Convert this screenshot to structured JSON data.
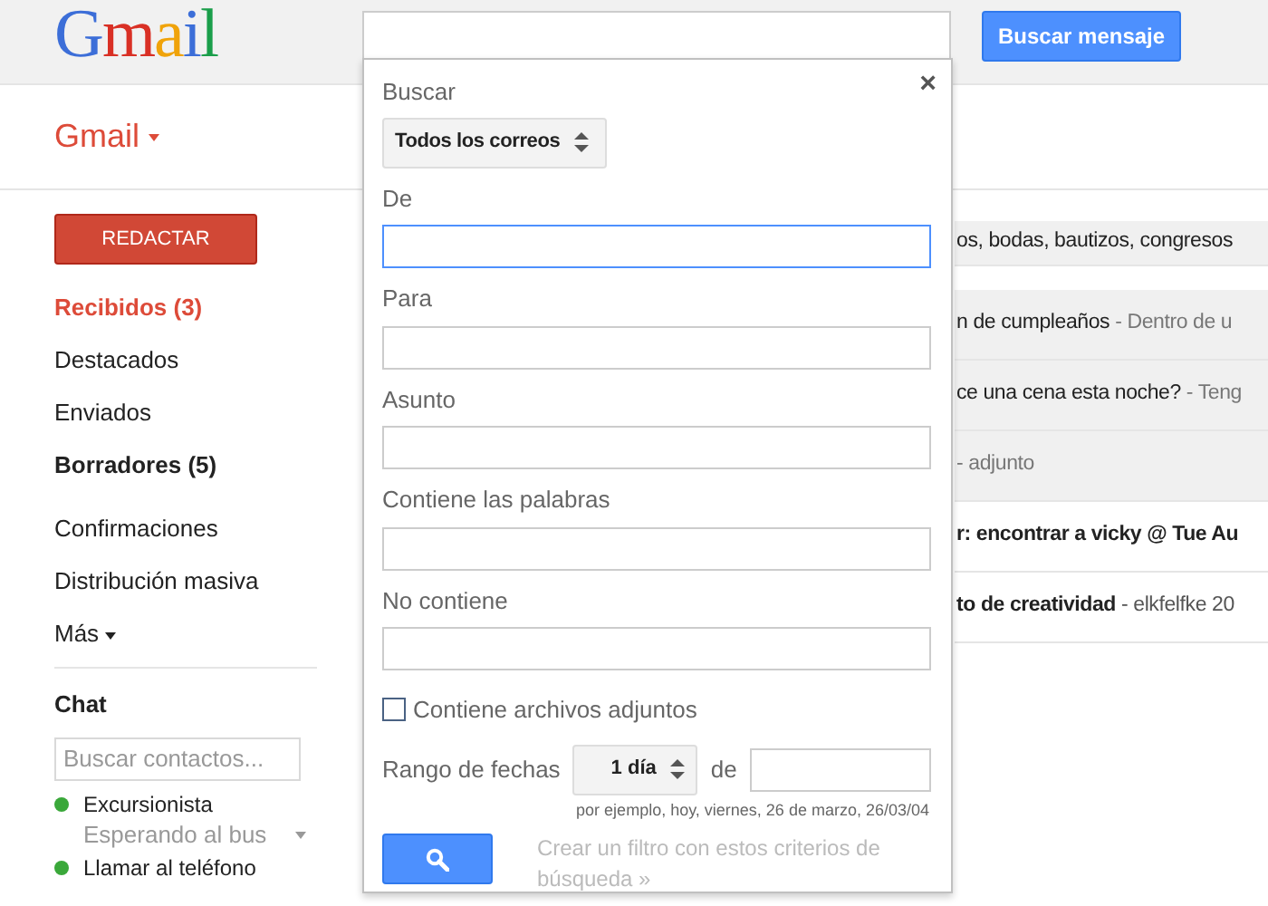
{
  "header": {
    "logo": "Gmail",
    "search_button": "Buscar mensaje"
  },
  "app_menu": "Gmail",
  "compose_button": "REDACTAR",
  "nav": [
    {
      "label": "Recibidos (3)",
      "selected": true,
      "bold": true
    },
    {
      "label": "Destacados",
      "selected": false,
      "bold": false
    },
    {
      "label": "Enviados",
      "selected": false,
      "bold": false
    },
    {
      "label": "Borradores (5)",
      "selected": false,
      "bold": true
    },
    {
      "label": "Confirmaciones",
      "selected": false,
      "bold": false
    },
    {
      "label": "Distribución masiva",
      "selected": false,
      "bold": false
    },
    {
      "label": "Más",
      "selected": false,
      "bold": false,
      "kind": "more"
    }
  ],
  "chat": {
    "title": "Chat",
    "search_placeholder": "Buscar contactos...",
    "contacts": [
      {
        "name": "Excursionista",
        "status": "Esperando al bus",
        "color": "#3aa83a"
      },
      {
        "name": "Llamar al teléfono",
        "color": "#3aa83a"
      }
    ]
  },
  "emails": [
    {
      "subject": "os, bodas, bautizos, congresos",
      "unread": false
    },
    {
      "subject": "n de cumpleaños",
      "snippet": "- Dentro de u",
      "unread": false
    },
    {
      "subject": "ce una cena esta noche?",
      "snippet": "- Teng",
      "unread": false
    },
    {
      "snippet": "- adjunto",
      "unread": false
    },
    {
      "subject": "r: encontrar a vicky @ Tue Au",
      "unread": true
    },
    {
      "subject": "to de creatividad",
      "snippet": "- elkfelfke 20",
      "unread": true
    }
  ],
  "search_dialog": {
    "close": "×",
    "scope_label": "Buscar",
    "scope": "Todos los correos",
    "fields": [
      {
        "label": "De",
        "focused": true
      },
      {
        "label": "Para",
        "focused": false
      },
      {
        "label": "Asunto",
        "focused": false
      },
      {
        "label": "Contiene las palabras",
        "focused": false
      },
      {
        "label": "No contiene",
        "focused": false
      }
    ],
    "attachments": {
      "label": "Contiene archivos adjuntos",
      "checked": false
    },
    "date_range": {
      "label": "Rango de fechas",
      "value": "1 día",
      "connector": "de",
      "hint": "por ejemplo, hoy, viernes, 26 de marzo, 26/03/04"
    },
    "filter_link": "Crear un filtro con estos criterios de búsqueda »"
  }
}
